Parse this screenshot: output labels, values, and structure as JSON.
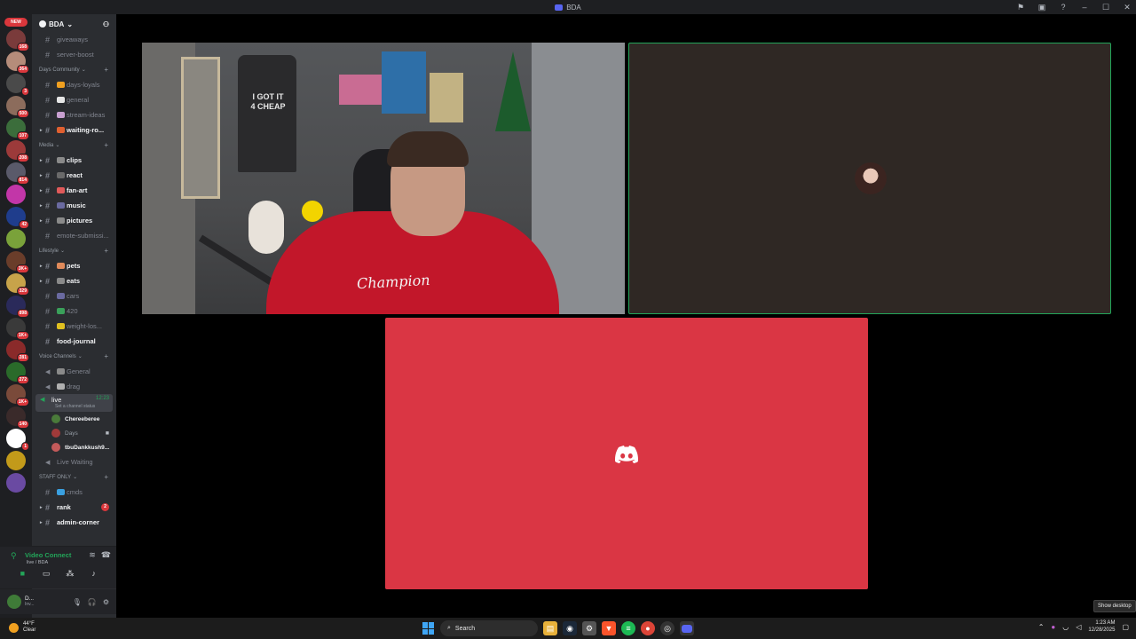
{
  "window": {
    "title": "BDA"
  },
  "rail": {
    "new_label": "NEW",
    "servers": [
      {
        "badge": "168",
        "color": "#7a3b3b"
      },
      {
        "badge": "364",
        "color": "#b58c7a"
      },
      {
        "badge": "3",
        "color": "#4a4a4a"
      },
      {
        "badge": "500",
        "color": "#8c6c5c"
      },
      {
        "badge": "107",
        "color": "#3b6d3b"
      },
      {
        "badge": "208",
        "color": "#9c3a3a"
      },
      {
        "badge": "814",
        "color": "#5a5a6a"
      },
      {
        "badge": "",
        "color": "#c236a8"
      },
      {
        "badge": "42",
        "color": "#1f3d8c"
      },
      {
        "badge": "",
        "color": "#7aa23a"
      },
      {
        "badge": "3K+",
        "color": "#6a3d2a"
      },
      {
        "badge": "329",
        "color": "#c7a34a"
      },
      {
        "badge": "898",
        "color": "#2a2a5a"
      },
      {
        "badge": "1K+",
        "color": "#3a3a3a"
      },
      {
        "badge": "281",
        "color": "#8a2a2a"
      },
      {
        "badge": "272",
        "color": "#2a6a2a"
      },
      {
        "badge": "1K+",
        "color": "#7a4a3a"
      },
      {
        "badge": "140",
        "color": "#3a2a2a"
      },
      {
        "badge": "1",
        "color": "#ffffff"
      },
      {
        "badge": "",
        "color": "#c29a1a"
      },
      {
        "badge": "",
        "color": "#6a4aa2"
      }
    ]
  },
  "sidebar": {
    "server_name": "BDA",
    "channels_top": [
      {
        "name": "giveaways",
        "unread": false
      },
      {
        "name": "server-boost",
        "unread": false
      }
    ],
    "categories": [
      {
        "title": "Days Community",
        "channels": [
          {
            "name": "days-loyals",
            "unread": false,
            "emo": "#f0a020"
          },
          {
            "name": "general",
            "unread": false,
            "emo": "#e6e6e6"
          },
          {
            "name": "stream-ideas",
            "unread": false,
            "emo": "#c8a0d0"
          },
          {
            "name": "waiting-ro...",
            "unread": true,
            "emo": "#e06030",
            "arrow": true
          }
        ]
      },
      {
        "title": "Media",
        "channels": [
          {
            "name": "clips",
            "unread": true,
            "emo": "#8a8a8a",
            "arrow": true
          },
          {
            "name": "react",
            "unread": true,
            "emo": "#6a6a6a",
            "arrow": true
          },
          {
            "name": "fan-art",
            "unread": true,
            "emo": "#e05a5a",
            "arrow": true
          },
          {
            "name": "music",
            "unread": true,
            "emo": "#6a6aa0",
            "arrow": true
          },
          {
            "name": "pictures",
            "unread": true,
            "emo": "#8a8a8a",
            "arrow": true
          },
          {
            "name": "emote-submissi...",
            "unread": false,
            "emo": ""
          }
        ]
      },
      {
        "title": "Lifestyle",
        "channels": [
          {
            "name": "pets",
            "unread": true,
            "emo": "#e08a5a",
            "arrow": true
          },
          {
            "name": "eats",
            "unread": true,
            "emo": "#8a8a8a",
            "arrow": true
          },
          {
            "name": "cars",
            "unread": false,
            "emo": "#6a6aa0"
          },
          {
            "name": "420",
            "unread": false,
            "emo": "#3aa05a"
          },
          {
            "name": "weight-los...",
            "unread": false,
            "emo": "#e0c020"
          },
          {
            "name": "food-journal",
            "unread": true,
            "emo": ""
          }
        ]
      }
    ],
    "voice": {
      "title": "Voice Channels",
      "channels": [
        {
          "name": "General",
          "emo": "#8a8a8a"
        },
        {
          "name": "drag",
          "emo": "#b0b0b0"
        }
      ],
      "active_channel": "live",
      "active_time": "12:23",
      "status_prompt": "Set a channel status",
      "users": [
        {
          "name": "Chereeberee",
          "color": "#4a7a3a",
          "bold": true
        },
        {
          "name": "Days",
          "color": "#a03a3a",
          "bold": false,
          "cam": true
        },
        {
          "name": "tbuDankkush9...",
          "color": "#c25a5a",
          "bold": true
        }
      ],
      "extra": "Live Waiting"
    },
    "staff": {
      "title": "STAFF ONLY",
      "channels": [
        {
          "name": "cmds",
          "unread": false,
          "emo": "#3aa0e0"
        },
        {
          "name": "rank",
          "unread": true,
          "badge": "2",
          "arrow": true
        },
        {
          "name": "admin-corner",
          "unread": true,
          "arrow": true
        }
      ]
    }
  },
  "voice_panel": {
    "title": "Video Connect",
    "subtitle": "live / BDA"
  },
  "user_panel": {
    "name": "D...",
    "status": "Inv..."
  },
  "stage": {
    "shirt_text": "I GOT IT 4 CHEAP",
    "hoodie_text": "Champion"
  },
  "taskbar": {
    "temp": "44°F",
    "condition": "Clear",
    "search_placeholder": "Search",
    "time": "1:23 AM",
    "date": "12/28/2025",
    "show_desktop": "Show desktop"
  }
}
